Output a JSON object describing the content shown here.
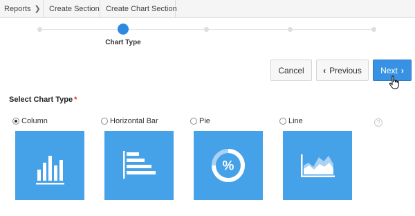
{
  "breadcrumb": {
    "items": [
      "Reports",
      "Create Section",
      "Create Chart Section"
    ]
  },
  "stepper": {
    "active_label": "Chart Type",
    "total_steps": 5,
    "active_index": 1
  },
  "buttons": {
    "cancel": "Cancel",
    "previous": "Previous",
    "next": "Next"
  },
  "section": {
    "title": "Select Chart Type",
    "required_mark": "*"
  },
  "chart_types": [
    {
      "label": "Column",
      "selected": true,
      "icon": "column-chart-icon"
    },
    {
      "label": "Horizontal Bar",
      "selected": false,
      "icon": "horizontal-bar-chart-icon"
    },
    {
      "label": "Pie",
      "selected": false,
      "icon": "pie-chart-icon"
    },
    {
      "label": "Line",
      "selected": false,
      "icon": "area-line-chart-icon"
    }
  ],
  "help": "?",
  "colors": {
    "accent": "#3892e3",
    "tile": "#45a2e8",
    "required": "#e0261c"
  }
}
